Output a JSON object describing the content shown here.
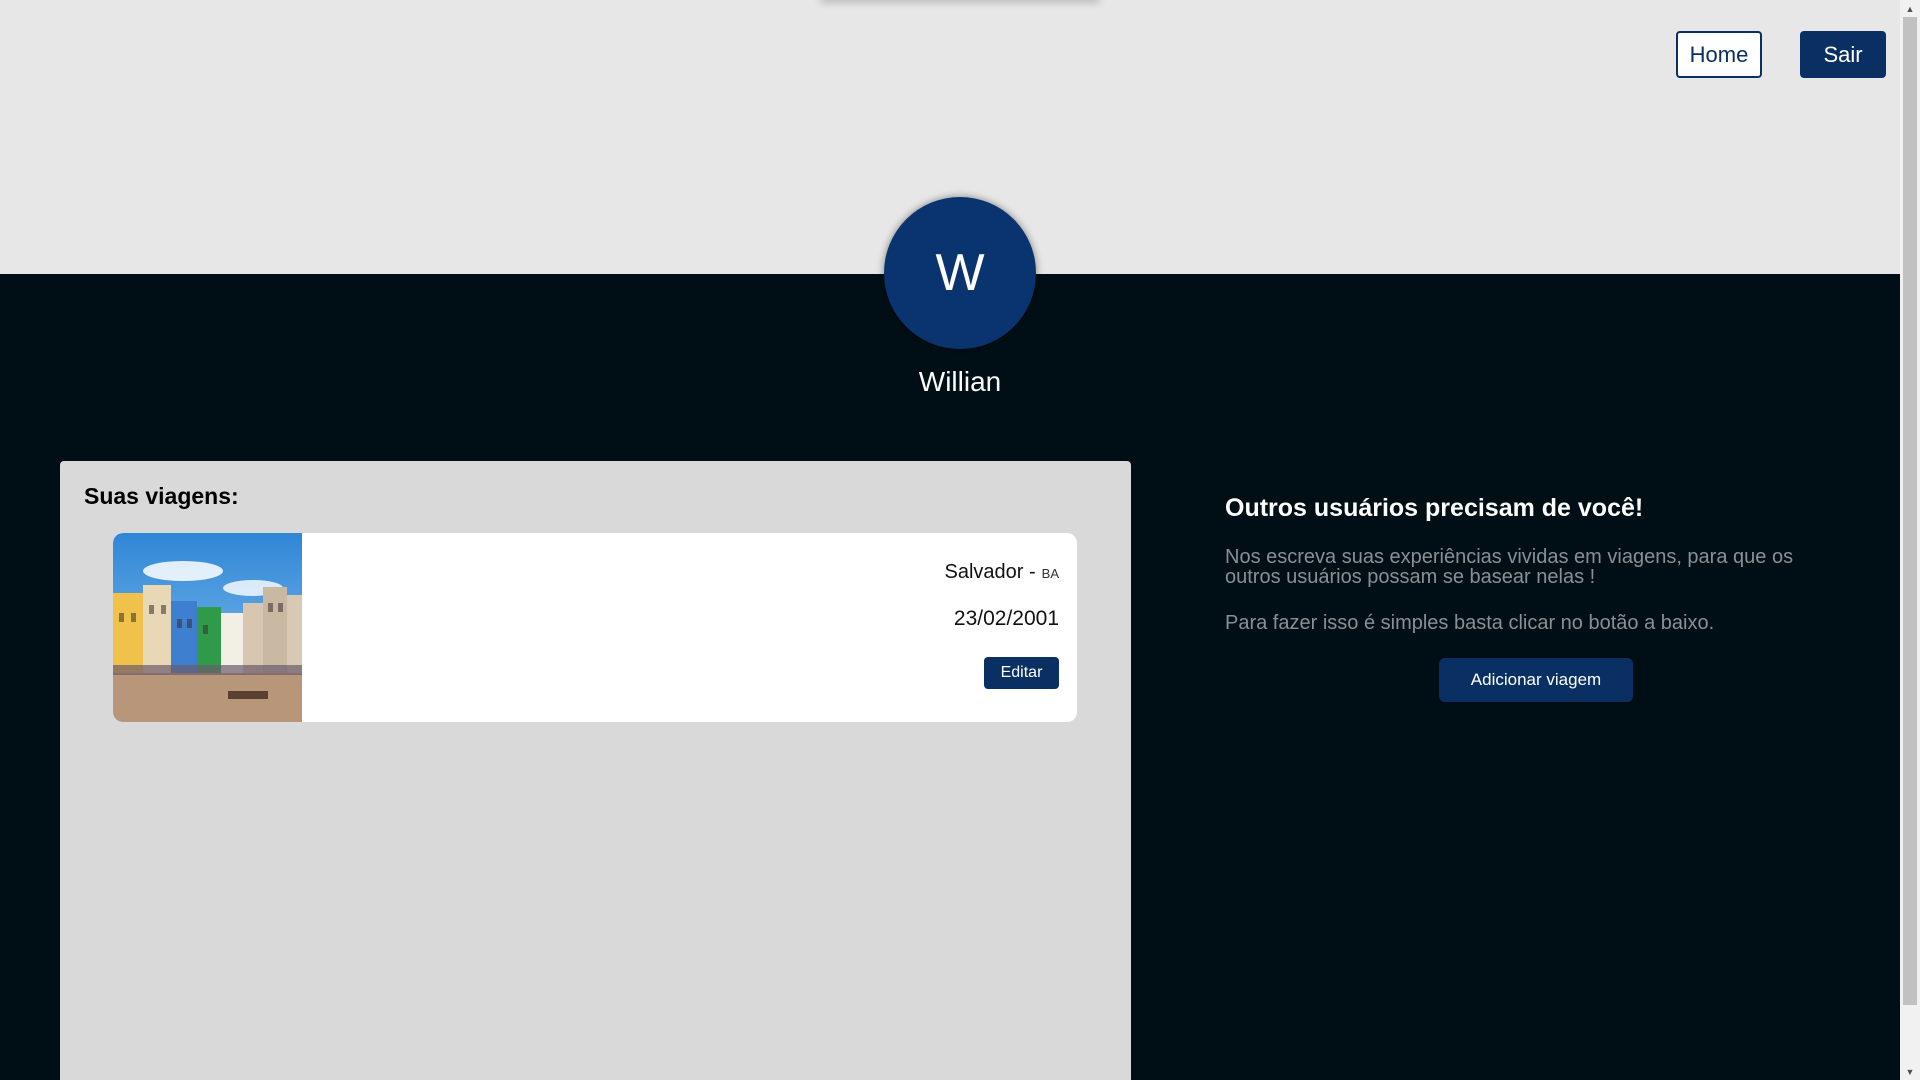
{
  "header": {
    "home_label": "Home",
    "logout_label": "Sair"
  },
  "profile": {
    "initial": "W",
    "name": "Willian"
  },
  "trips": {
    "title": "Suas viagens:",
    "items": [
      {
        "city": "Salvador -",
        "state": "BA",
        "date": "23/02/2001",
        "edit_label": "Editar"
      }
    ]
  },
  "info": {
    "title": "Outros usuários precisam de você!",
    "paragraph1": "Nos escreva suas experiências vividas em viagens, para que os outros usuários possam se basear nelas !",
    "paragraph2": "Para fazer isso é simples basta clicar no botão a baixo.",
    "add_button_label": "Adicionar viagem"
  },
  "colors": {
    "brand_navy": "#0a2f63",
    "page_dark": "#000f16",
    "header_bg": "#e7e7e7",
    "panel_bg": "#d9d9d9",
    "muted_text": "#8a8f93"
  },
  "icons": {
    "scroll_up": "scroll-up-arrow-icon",
    "scroll_down": "scroll-down-arrow-icon"
  }
}
